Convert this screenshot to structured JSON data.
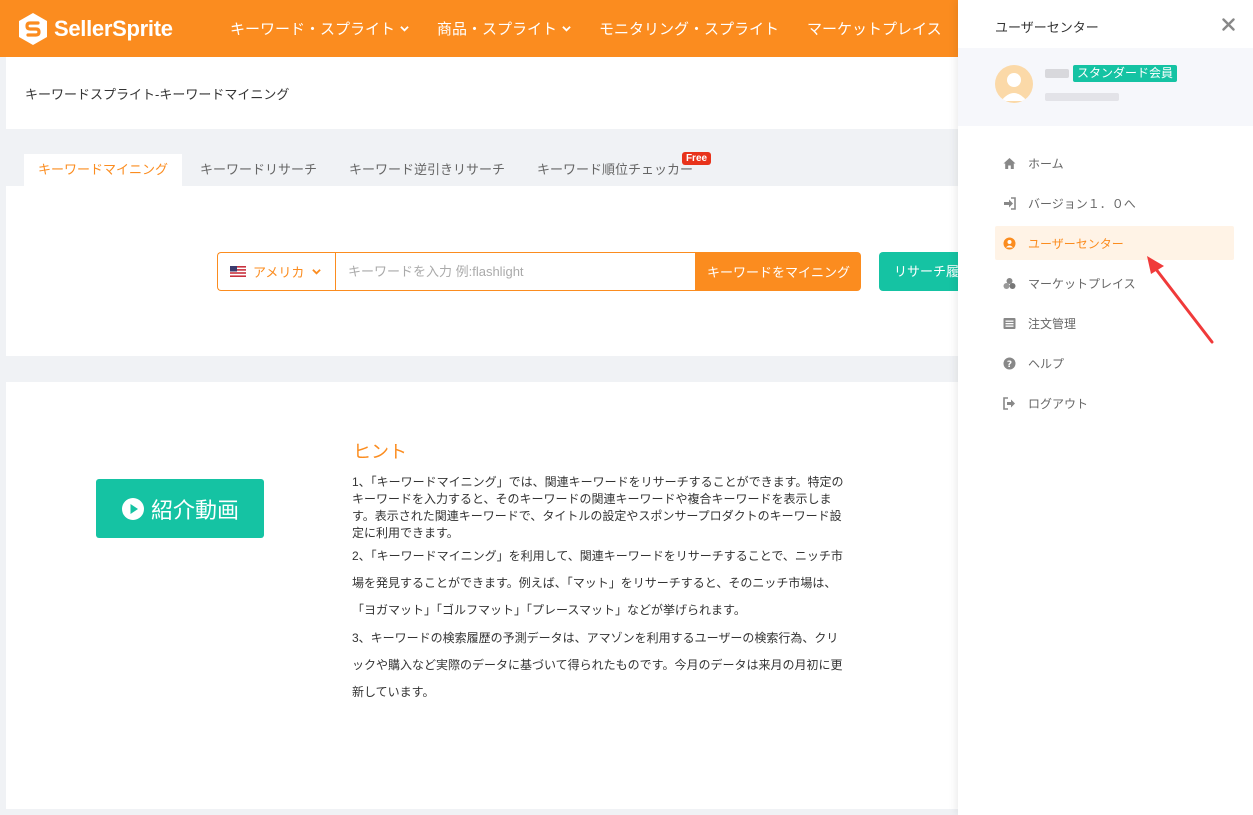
{
  "header": {
    "logo_text": "SellerSprite",
    "nav": [
      {
        "label": "キーワード・スプライト",
        "has_dropdown": true
      },
      {
        "label": "商品・スプライト",
        "has_dropdown": true
      },
      {
        "label": "モニタリング・スプライト",
        "has_dropdown": false
      },
      {
        "label": "マーケットプレイス",
        "has_dropdown": false
      }
    ]
  },
  "breadcrumb": "キーワードスプライト-キーワードマイニング",
  "tabs": [
    {
      "label": "キーワードマイニング",
      "active": true
    },
    {
      "label": "キーワードリサーチ",
      "active": false
    },
    {
      "label": "キーワード逆引きリサーチ",
      "active": false
    },
    {
      "label": "キーワード順位チェッカー",
      "active": false,
      "badge": "Free"
    }
  ],
  "search": {
    "country": "アメリカ",
    "placeholder": "キーワードを入力 例:flashlight",
    "value": "",
    "submit_label": "キーワードをマイニング",
    "history_label": "リサーチ履"
  },
  "hint": {
    "video_label": "紹介動画",
    "title": "ヒント",
    "paragraphs": [
      "1、「キーワードマイニング」では、関連キーワードをリサーチすることができます。特定のキーワードを入力すると、そのキーワードの関連キーワードや複合キーワードを表示します。表示された関連キーワードで、タイトルの設定やスポンサープロダクトのキーワード設定に利用できます。",
      "2、「キーワードマイニング」を利用して、関連キーワードをリサーチすることで、ニッチ市場を発見することができます。例えば、「マット」をリサーチすると、そのニッチ市場は、「ヨガマット」「ゴルフマット」「プレースマット」などが挙げられます。",
      "3、キーワードの検索履歴の予測データは、アマゾンを利用するユーザーの検索行為、クリックや購入など実際のデータに基づいて得られたものです。今月のデータは来月の月初に更新しています。"
    ]
  },
  "drawer": {
    "title": "ユーザーセンター",
    "badge": "スタンダード会員",
    "menu": [
      {
        "label": "ホーム",
        "icon": "home-icon",
        "active": false
      },
      {
        "label": "バージョン１．０へ",
        "icon": "sign-in-icon",
        "active": false
      },
      {
        "label": "ユーザーセンター",
        "icon": "user-circle-icon",
        "active": true
      },
      {
        "label": "マーケットプレイス",
        "icon": "cubes-icon",
        "active": false
      },
      {
        "label": "注文管理",
        "icon": "list-icon",
        "active": false
      },
      {
        "label": "ヘルプ",
        "icon": "question-circle-icon",
        "active": false
      },
      {
        "label": "ログアウト",
        "icon": "sign-out-icon",
        "active": false
      }
    ]
  },
  "colors": {
    "brand_orange": "#fb8c1f",
    "teal": "#15c3a3",
    "free_red": "#e8331b",
    "annotation_red": "#f03a3a"
  }
}
